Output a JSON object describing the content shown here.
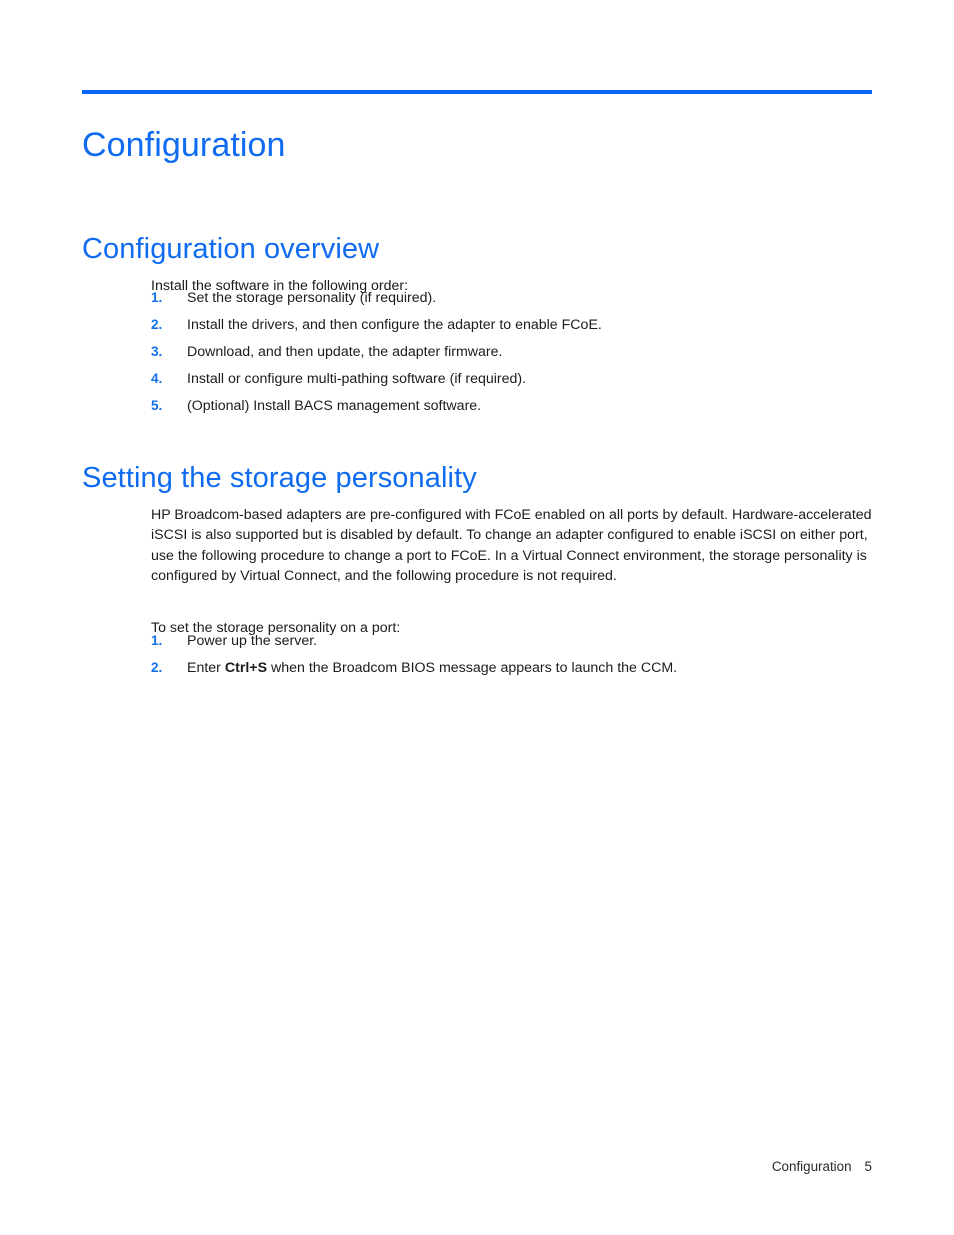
{
  "document": {
    "chapter_title": "Configuration",
    "sections": [
      {
        "heading": "Configuration overview",
        "intro": "Install the software in the following order:",
        "steps": [
          {
            "number": "1.",
            "text": "Set the storage personality (if required)."
          },
          {
            "number": "2.",
            "text": "Install the drivers, and then configure the adapter to enable FCoE."
          },
          {
            "number": "3.",
            "text": "Download, and then update, the adapter firmware."
          },
          {
            "number": "4.",
            "text": "Install or configure multi-pathing software (if required)."
          },
          {
            "number": "5.",
            "text": "(Optional) Install BACS management software."
          }
        ]
      },
      {
        "heading": "Setting the storage personality",
        "paragraph": "HP Broadcom-based adapters are pre-configured with FCoE enabled on all ports by default. Hardware-accelerated iSCSI is also supported but is disabled by default. To change an adapter configured to enable iSCSI on either port, use the following procedure to change a port to FCoE. In a Virtual Connect environment, the storage personality is configured by Virtual Connect, and the following procedure is not required.",
        "intro": "To set the storage personality on a port:",
        "steps": [
          {
            "number": "1.",
            "text": "Power up the server.",
            "prefix": "",
            "bold": "",
            "suffix": ""
          },
          {
            "number": "2.",
            "text": "Enter Ctrl+S when the Broadcom BIOS message appears to launch the CCM.",
            "prefix": "Enter ",
            "bold": "Ctrl+S",
            "suffix": " when the Broadcom BIOS message appears to launch the CCM."
          }
        ]
      }
    ]
  },
  "footer": {
    "section_label": "Configuration",
    "page_number": "5"
  },
  "colors": {
    "heading_blue": "#0f6bf0",
    "rule_blue": "#0a66f5",
    "marker_blue": "#1271e8",
    "body_text": "#1c1c1c",
    "page_background": "#ffffff"
  }
}
